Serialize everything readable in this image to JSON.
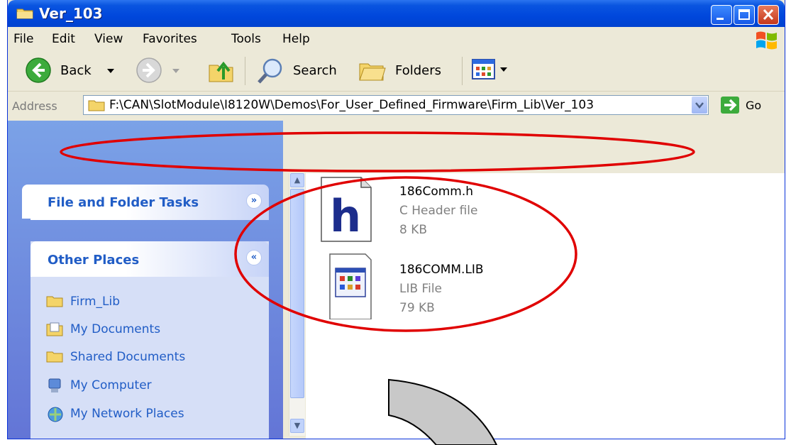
{
  "window": {
    "title": "Ver_103"
  },
  "menu": {
    "items": [
      "File",
      "Edit",
      "View",
      "Favorites",
      "Tools",
      "Help"
    ]
  },
  "toolbar": {
    "back_label": "Back",
    "search_label": "Search",
    "folders_label": "Folders"
  },
  "address": {
    "label": "Address",
    "path": "F:\\CAN\\SlotModule\\I8120W\\Demos\\For_User_Defined_Firmware\\Firm_Lib\\Ver_103",
    "go_label": "Go"
  },
  "tasks": {
    "file_folder_title": "File and Folder Tasks",
    "other_places_title": "Other Places",
    "places": [
      "Firm_Lib",
      "My Documents",
      "Shared Documents",
      "My Computer",
      "My Network Places"
    ]
  },
  "files": [
    {
      "name": "186Comm.h",
      "type": "C Header file",
      "size": "8 KB",
      "icon_letter": "h"
    },
    {
      "name": "186COMM.LIB",
      "type": "LIB File",
      "size": "79 KB"
    }
  ],
  "colors": {
    "annotation": "#e00000",
    "titlebar": "#0047dc",
    "link": "#215dc6"
  }
}
